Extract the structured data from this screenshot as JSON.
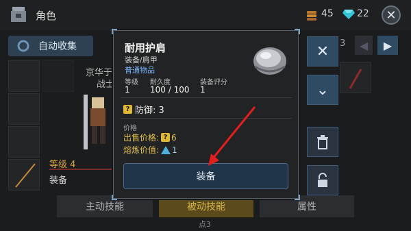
{
  "header": {
    "title": "角色",
    "resources": [
      {
        "name": "gold",
        "value": "45",
        "icon": "gold-stack-icon",
        "color": "#c98a3a"
      },
      {
        "name": "gems",
        "value": "22",
        "icon": "diamond-icon",
        "color": "#33c6d6"
      }
    ],
    "close_icon": "close-icon"
  },
  "left_panel": {
    "auto_collect_label": "自动收集",
    "character_name_partial": "京华于",
    "class_partial": "战士",
    "level_label": "等级 4",
    "equip_label": "装备"
  },
  "tabs": [
    {
      "label": "主动技能",
      "active": false
    },
    {
      "label": "被动技能",
      "active": true
    },
    {
      "label": "属性",
      "active": false
    }
  ],
  "points_label": "点3",
  "page_indicator": "3",
  "modal": {
    "name": "耐用护肩",
    "type": "装备/肩甲",
    "rarity": "普通物品",
    "stats": [
      {
        "label": "等级",
        "value": "1"
      },
      {
        "label": "耐久度",
        "value": "100 / 100"
      },
      {
        "label": "装备评分",
        "value": "1"
      }
    ],
    "defense_label": "防御: 3",
    "price_title": "价格",
    "sell_label": "出售价格:",
    "sell_value": "6",
    "smelt_label": "熔炼价值:",
    "smelt_value": "1",
    "equip_button": "装备"
  },
  "colors": {
    "accent_blue": "#2f4a63",
    "gold_text": "#e2c14a",
    "rarity_blue": "#79b4ff",
    "arrow_red": "#e01f1f"
  }
}
